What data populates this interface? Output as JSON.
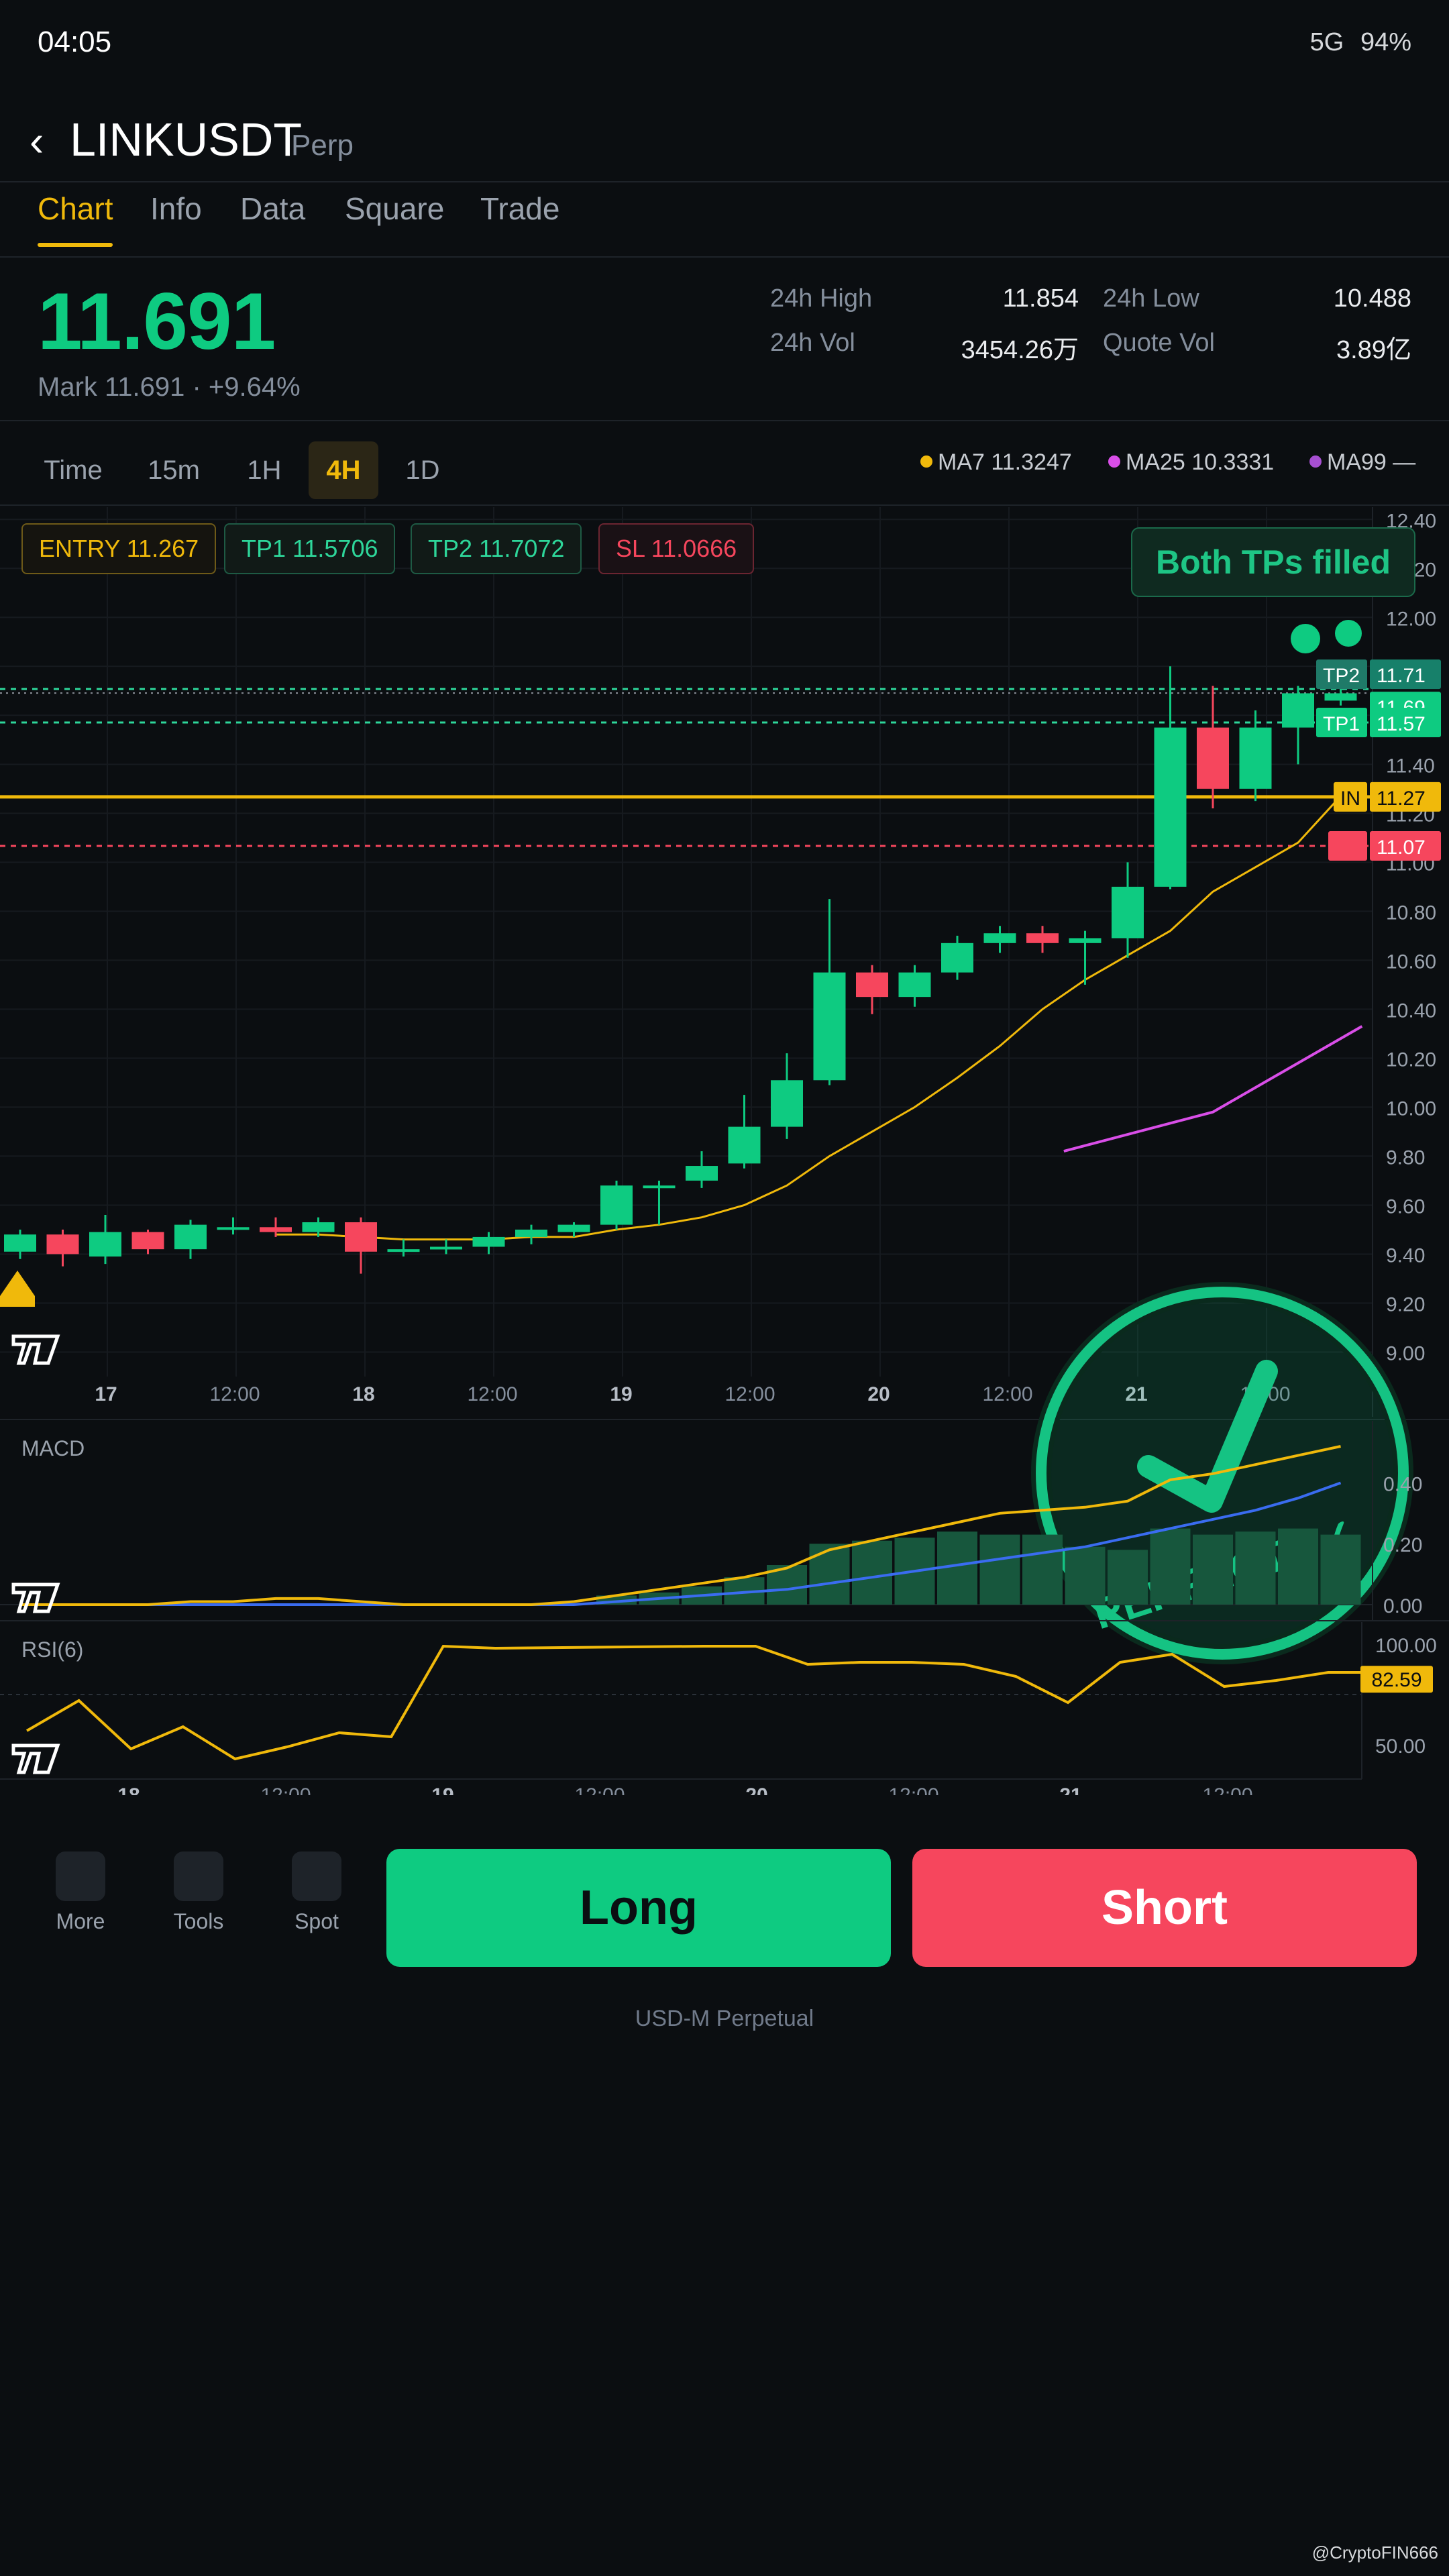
{
  "status": {
    "time": "04:05",
    "network": "5G",
    "battery": "94%"
  },
  "header": {
    "back": "‹",
    "symbol": "LINKUSDT",
    "type": "Perp"
  },
  "tabs": [
    "Chart",
    "Info",
    "Data",
    "Square",
    "Trade"
  ],
  "price": {
    "last": "11.691",
    "mark_line": "Mark 11.691 · +9.64%"
  },
  "stats": {
    "high_label": "24h High",
    "high": "11.854",
    "low_label": "24h Low",
    "low": "10.488",
    "vol_label": "24h Vol",
    "vol": "3454.26万",
    "qvol_label": "Quote Vol",
    "qvol": "3.89亿"
  },
  "timeframes": [
    "Time",
    "15m",
    "1H",
    "4H",
    "1D"
  ],
  "active_timeframe": "4H",
  "ma": {
    "ma7": "MA7 11.3247",
    "ma25": "MA25 10.3331",
    "ma99": "MA99 —",
    "colors": {
      "ma7": "#f0b90b",
      "ma25": "#d94ee8",
      "ma99": "#a64fd1"
    }
  },
  "levels": {
    "entry": "ENTRY 11.267",
    "tp1": "TP1 11.5706",
    "tp2": "TP2 11.7072",
    "sl": "SL 11.0666"
  },
  "filled_badge": "Both TPs filled",
  "stamp_text": "PERFECT✓✓",
  "chart_data": {
    "type": "candlestick",
    "timeframe": "4H",
    "x_labels": [
      "17",
      "12:00",
      "18",
      "12:00",
      "19",
      "12:00",
      "20",
      "12:00",
      "21",
      "12:00"
    ],
    "y_ticks": [
      "12.40",
      "12.20",
      "12.00",
      "11.80",
      "11.60",
      "11.40",
      "11.20",
      "11.00",
      "10.80",
      "10.60",
      "10.40",
      "10.20",
      "10.00",
      "9.80",
      "9.60",
      "9.40",
      "9.20",
      "9.00"
    ],
    "ylim": [
      8.9,
      12.45
    ],
    "candles": [
      [
        9.41,
        9.48,
        9.38,
        9.5
      ],
      [
        9.48,
        9.4,
        9.35,
        9.5
      ],
      [
        9.39,
        9.49,
        9.36,
        9.56
      ],
      [
        9.49,
        9.42,
        9.4,
        9.5
      ],
      [
        9.42,
        9.52,
        9.38,
        9.54
      ],
      [
        9.51,
        9.51,
        9.48,
        9.55
      ],
      [
        9.51,
        9.49,
        9.47,
        9.55
      ],
      [
        9.49,
        9.53,
        9.47,
        9.55
      ],
      [
        9.53,
        9.41,
        9.32,
        9.55
      ],
      [
        9.41,
        9.42,
        9.39,
        9.46
      ],
      [
        9.42,
        9.43,
        9.4,
        9.46
      ],
      [
        9.43,
        9.47,
        9.4,
        9.49
      ],
      [
        9.47,
        9.5,
        9.44,
        9.52
      ],
      [
        9.49,
        9.52,
        9.47,
        9.53
      ],
      [
        9.52,
        9.68,
        9.5,
        9.7
      ],
      [
        9.68,
        9.68,
        9.52,
        9.7
      ],
      [
        9.7,
        9.76,
        9.67,
        9.82
      ],
      [
        9.77,
        9.92,
        9.75,
        10.05
      ],
      [
        9.92,
        10.11,
        9.87,
        10.22
      ],
      [
        10.11,
        10.55,
        10.09,
        10.85
      ],
      [
        10.55,
        10.45,
        10.38,
        10.58
      ],
      [
        10.45,
        10.55,
        10.41,
        10.58
      ],
      [
        10.55,
        10.67,
        10.52,
        10.7
      ],
      [
        10.67,
        10.71,
        10.63,
        10.74
      ],
      [
        10.71,
        10.67,
        10.63,
        10.74
      ],
      [
        10.67,
        10.69,
        10.5,
        10.72
      ],
      [
        10.69,
        10.9,
        10.61,
        11.0
      ],
      [
        10.9,
        11.55,
        10.89,
        11.8
      ],
      [
        11.55,
        11.3,
        11.22,
        11.72
      ],
      [
        11.3,
        11.55,
        11.25,
        11.62
      ],
      [
        11.55,
        11.69,
        11.4,
        11.72
      ],
      [
        11.66,
        11.69,
        11.64,
        11.71
      ]
    ],
    "ma7": [
      null,
      null,
      null,
      null,
      null,
      null,
      9.48,
      9.48,
      9.47,
      9.46,
      9.46,
      9.46,
      9.47,
      9.47,
      9.5,
      9.52,
      9.55,
      9.6,
      9.68,
      9.8,
      9.9,
      10.0,
      10.12,
      10.25,
      10.4,
      10.52,
      10.62,
      10.72,
      10.88,
      10.98,
      11.08,
      11.27
    ],
    "ma25": [
      [
        24.5,
        9.82
      ],
      [
        28,
        9.98
      ],
      [
        31.5,
        10.33
      ]
    ],
    "levels": {
      "tp2": 11.7072,
      "mark": 11.691,
      "tp1": 11.5706,
      "entry": 11.267,
      "sl": 11.0666
    },
    "axis_tags": {
      "tp2": "TP2",
      "tp2_v": "11.71",
      "mark": "11.69",
      "tp1": "TP1",
      "tp1_v": "11.57",
      "entry": "IN",
      "entry_v": "11.27",
      "sl_v": "11.07"
    },
    "macd": {
      "label": "MACD",
      "y_ticks": [
        "0.40",
        "0.20",
        "0.00"
      ],
      "ylim": [
        0,
        0.52
      ],
      "hist": [
        0,
        0,
        0,
        0,
        0,
        0,
        0,
        0,
        0,
        0,
        0,
        0,
        0,
        0,
        0.03,
        0.04,
        0.06,
        0.09,
        0.13,
        0.2,
        0.21,
        0.22,
        0.24,
        0.23,
        0.23,
        0.19,
        0.18,
        0.25,
        0.23,
        0.24,
        0.25,
        0.23
      ],
      "macd": [
        0.0,
        0.0,
        0.0,
        0.0,
        0.01,
        0.01,
        0.02,
        0.02,
        0.01,
        0.0,
        0.0,
        0.0,
        0.0,
        0.01,
        0.03,
        0.05,
        0.07,
        0.09,
        0.12,
        0.18,
        0.21,
        0.24,
        0.27,
        0.3,
        0.31,
        0.32,
        0.34,
        0.41,
        0.43,
        0.46,
        0.49,
        0.52
      ],
      "signal": [
        0.0,
        0.0,
        0.0,
        0.0,
        0.0,
        0.0,
        0.0,
        0.0,
        0.0,
        0.0,
        0.0,
        0.0,
        0.0,
        0.0,
        0.01,
        0.02,
        0.03,
        0.04,
        0.05,
        0.07,
        0.09,
        0.11,
        0.13,
        0.15,
        0.17,
        0.19,
        0.22,
        0.25,
        0.28,
        0.31,
        0.35,
        0.4
      ]
    },
    "rsi": {
      "label": "RSI(6)",
      "y_ticks": [
        "100.00",
        "50.00"
      ],
      "ylim": [
        35,
        105
      ],
      "values": [
        [
          0,
          57
        ],
        [
          1,
          72
        ],
        [
          2,
          48
        ],
        [
          3,
          59
        ],
        [
          4,
          43
        ],
        [
          5,
          49
        ],
        [
          6,
          56
        ],
        [
          7,
          54
        ],
        [
          8,
          99
        ],
        [
          9,
          98
        ],
        [
          13,
          99
        ],
        [
          14,
          99
        ],
        [
          15,
          90
        ],
        [
          16,
          91
        ],
        [
          17,
          91
        ],
        [
          18,
          90
        ],
        [
          19,
          84
        ],
        [
          20,
          71
        ],
        [
          21,
          91
        ],
        [
          22,
          95
        ],
        [
          23,
          79
        ],
        [
          24,
          82
        ],
        [
          25,
          86
        ],
        [
          26,
          86
        ]
      ],
      "x_labels": [
        "18",
        "12:00",
        "19",
        "12:00",
        "20",
        "12:00",
        "21",
        "12:00"
      ],
      "last": "82.59"
    }
  },
  "actions": {
    "more": "More",
    "tools": "Tools",
    "spot": "Spot",
    "long": "Long",
    "short": "Short"
  },
  "footer": "USD-M Perpetual",
  "watermark": "@CryptoFIN666",
  "colors": {
    "up": "#0ecb81",
    "down": "#f6465d",
    "accent": "#f0b90b"
  }
}
